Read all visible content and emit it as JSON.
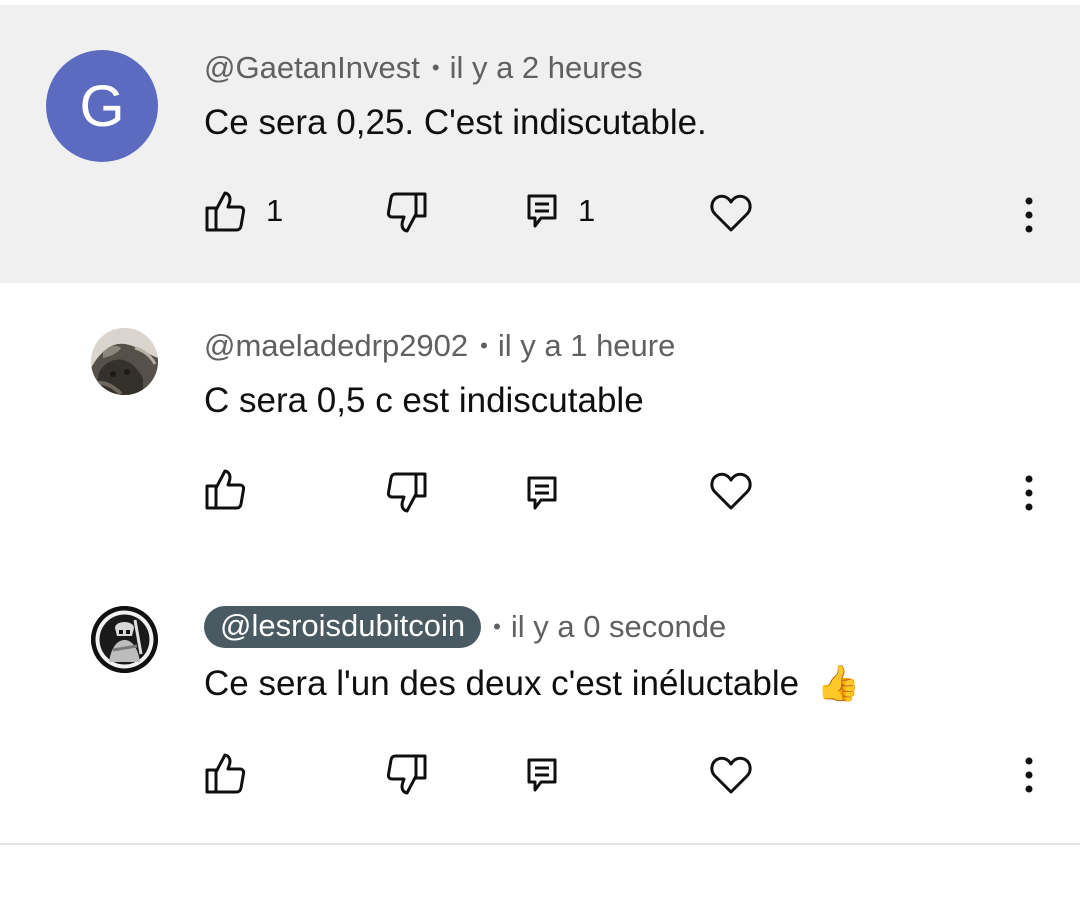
{
  "comments": [
    {
      "author": "@GaetanInvest",
      "time": "il y a 2 heures",
      "avatar_letter": "G",
      "avatar_color": "#5c6bc0",
      "text": "Ce sera 0,25. C'est indiscutable.",
      "likes": "1",
      "replies": "1",
      "highlighted": true
    },
    {
      "author": "@maeladedrp2902",
      "time": "il y a 1 heure",
      "avatar_icon": "cat-photo-avatar",
      "text": "C sera 0,5 c est indiscutable"
    },
    {
      "author": "@lesroisdubitcoin",
      "time": "il y a 0 seconde",
      "avatar_icon": "warrior-emblem-avatar",
      "text": "Ce sera l'un des deux c'est inéluctable",
      "emoji": "👍",
      "author_is_channel_owner": true
    }
  ],
  "separator": "•",
  "colors": {
    "highlight_bg": "#f0f0f0",
    "owner_chip_bg": "#4a5a63",
    "meta_text": "#606060"
  }
}
